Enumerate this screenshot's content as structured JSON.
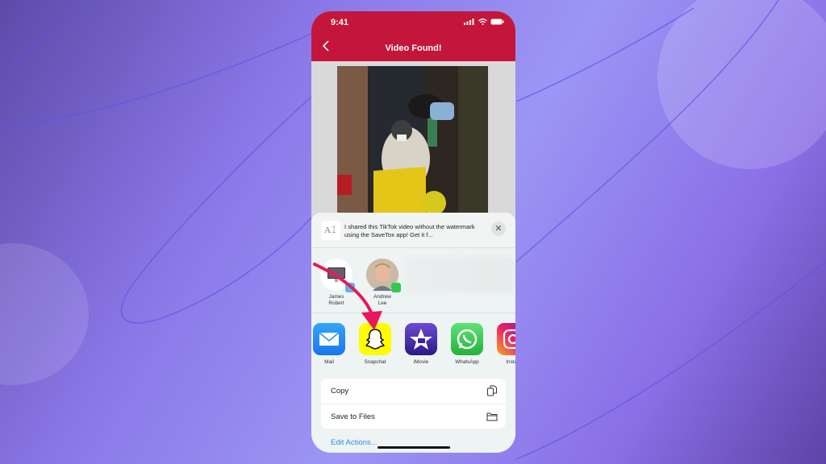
{
  "status_bar": {
    "time": "9:41"
  },
  "nav": {
    "title": "Video Found!"
  },
  "share_sheet": {
    "message": "I shared this TikTok video without the watermark using the SaveTox app! Get it f...",
    "text_icon_glyph": "A𝙸",
    "close_glyph": "✕",
    "people": [
      {
        "name_line1": "James",
        "name_line2": "Robert",
        "badge": "airdrop"
      },
      {
        "name_line1": "Andrew",
        "name_line2": "Lee",
        "badge": "whatsapp"
      }
    ],
    "apps": [
      {
        "label": "Mail",
        "color": "#1f8cf2"
      },
      {
        "label": "Snapchat",
        "color": "#fffc00"
      },
      {
        "label": "iMovie",
        "color": "#4a2fa8"
      },
      {
        "label": "WhatsApp",
        "color": "#2fcb4c"
      },
      {
        "label": "Instag",
        "color": "#d6249f"
      }
    ],
    "actions": [
      {
        "label": "Copy",
        "icon": "copy-icon"
      },
      {
        "label": "Save to Files",
        "icon": "folder-icon"
      }
    ],
    "edit_actions": "Edit Actions..."
  },
  "colors": {
    "brand": "#c4163a",
    "link": "#2f8de4",
    "arrow": "#e8185a"
  }
}
